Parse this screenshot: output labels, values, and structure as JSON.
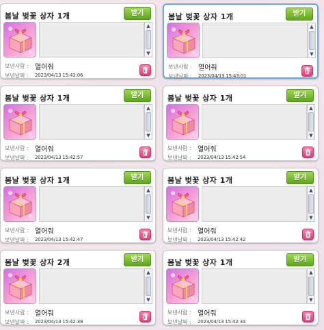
{
  "mailbox": {
    "items": [
      {
        "title": "봄날 벚꽃 상자 1개",
        "receive_label": "받기",
        "sender_label": "보낸사람 :",
        "sender": "열어줘",
        "date_label": "보낸날짜 :",
        "date": "2023/04/13 15:43:06",
        "selected": false
      },
      {
        "title": "봄날 벚꽃 상자 1개",
        "receive_label": "받기",
        "sender_label": "보낸사람 :",
        "sender": "열어줘",
        "date_label": "보낸날짜 :",
        "date": "2023/04/13 15:43:01",
        "selected": true
      },
      {
        "title": "봄날 벚꽃 상자 1개",
        "receive_label": "받기",
        "sender_label": "보낸사람 :",
        "sender": "열어줘",
        "date_label": "보낸날짜 :",
        "date": "2023/04/13 15:42:57",
        "selected": false
      },
      {
        "title": "봄날 벚꽃 상자 1개",
        "receive_label": "받기",
        "sender_label": "보낸사람 :",
        "sender": "열어줘",
        "date_label": "보낸날짜 :",
        "date": "2023/04/13 15:42:54",
        "selected": false
      },
      {
        "title": "봄날 벚꽃 상자 1개",
        "receive_label": "받기",
        "sender_label": "보낸사람 :",
        "sender": "열어줘",
        "date_label": "보낸날짜 :",
        "date": "2023/04/13 15:42:47",
        "selected": false
      },
      {
        "title": "봄날 벚꽃 상자 1개",
        "receive_label": "받기",
        "sender_label": "보낸사람 :",
        "sender": "열어줘",
        "date_label": "보낸날짜 :",
        "date": "2023/04/13 15:42:42",
        "selected": false
      },
      {
        "title": "봄날 벚꽃 상자 2개",
        "receive_label": "받기",
        "sender_label": "보낸사람 :",
        "sender": "열어줘",
        "date_label": "보낸날짜 :",
        "date": "2023/04/13 15:42:38",
        "selected": false
      },
      {
        "title": "봄날 벚꽃 상자 1개",
        "receive_label": "받기",
        "sender_label": "보낸사람 :",
        "sender": "열어줘",
        "date_label": "보낸날짜 :",
        "date": "2023/04/13 15:42:34",
        "selected": false
      }
    ],
    "icons": {
      "item": "cherry-blossom-gift-box-icon",
      "delete": "trash-icon"
    },
    "colors": {
      "receive_button": "#6bb22a",
      "delete_button": "#e84a83",
      "selected_border": "#6fa9d8"
    }
  }
}
